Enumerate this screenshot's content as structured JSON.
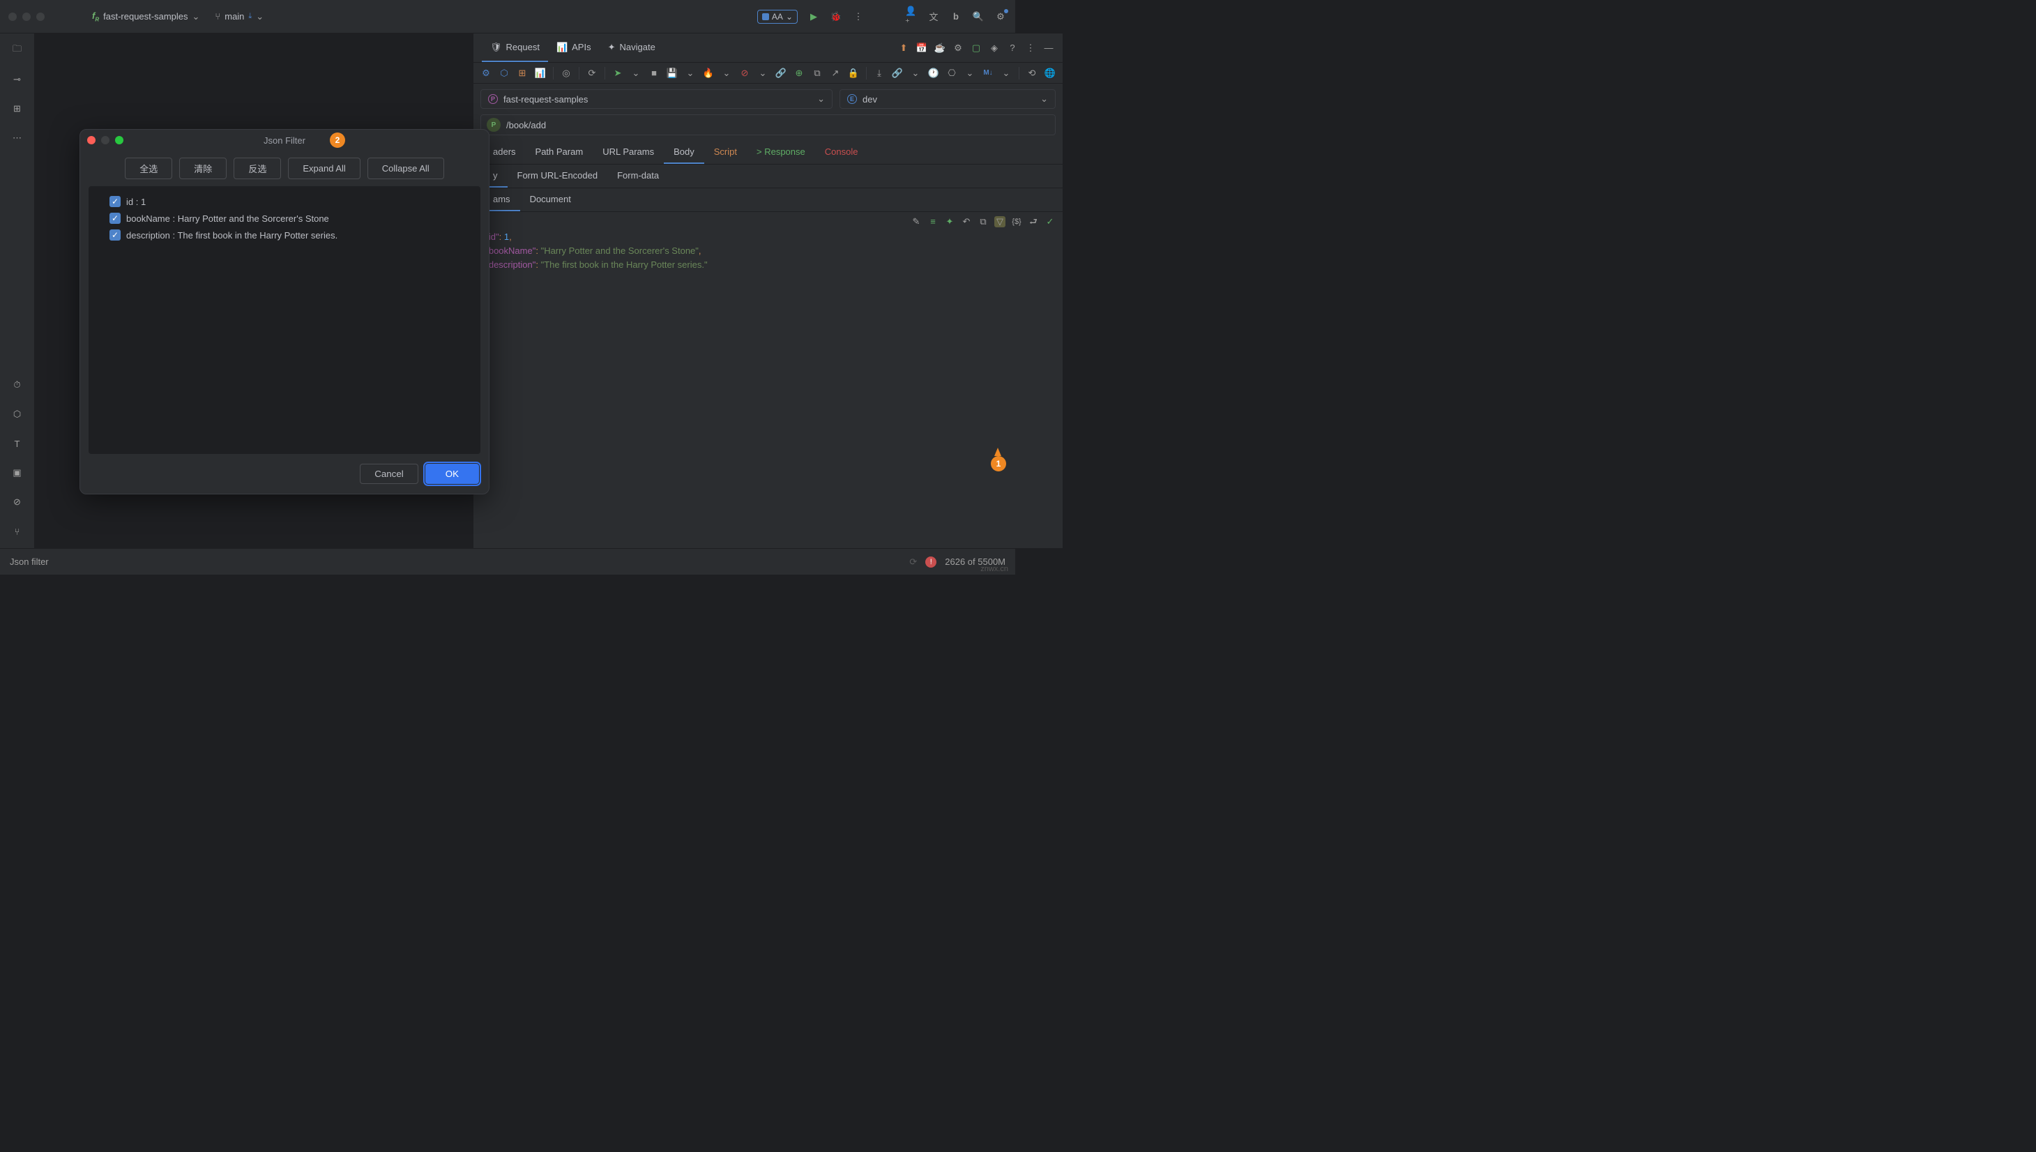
{
  "titlebar": {
    "project": "fast-request-samples",
    "branch": "main",
    "aa_label": "AA"
  },
  "right_pane": {
    "tabs": [
      "Request",
      "APIs",
      "Navigate"
    ],
    "project_dd": "fast-request-samples",
    "env_dd": "dev",
    "method": "P",
    "url": "/book/add",
    "sub_tabs1": [
      "aders",
      "Path Param",
      "URL Params",
      "Body",
      "Script",
      "> Response",
      "Console"
    ],
    "sub_tabs2": [
      "y",
      "Form URL-Encoded",
      "Form-data"
    ],
    "sub_tabs3": [
      "ams",
      "Document"
    ],
    "json": {
      "id_key": "\"id\"",
      "id_val": "1",
      "name_key": "\"bookName\"",
      "name_val": "\"Harry Potter and the Sorcerer's Stone\"",
      "desc_key": "\"description\"",
      "desc_val": "\"The first book in the Harry Potter series.\""
    }
  },
  "dialog": {
    "title": "Json Filter",
    "badge": "2",
    "buttons": {
      "select_all": "全选",
      "clear": "清除",
      "invert": "反选",
      "expand": "Expand All",
      "collapse": "Collapse All"
    },
    "items": [
      {
        "label": "id : 1"
      },
      {
        "label": "bookName : Harry Potter and the Sorcerer's Stone"
      },
      {
        "label": "description : The first book in the Harry Potter series."
      }
    ],
    "cancel": "Cancel",
    "ok": "OK"
  },
  "callout1": "1",
  "status": {
    "left": "Json filter",
    "mem": "2626 of 5500M"
  },
  "watermark": "znwx.cn"
}
